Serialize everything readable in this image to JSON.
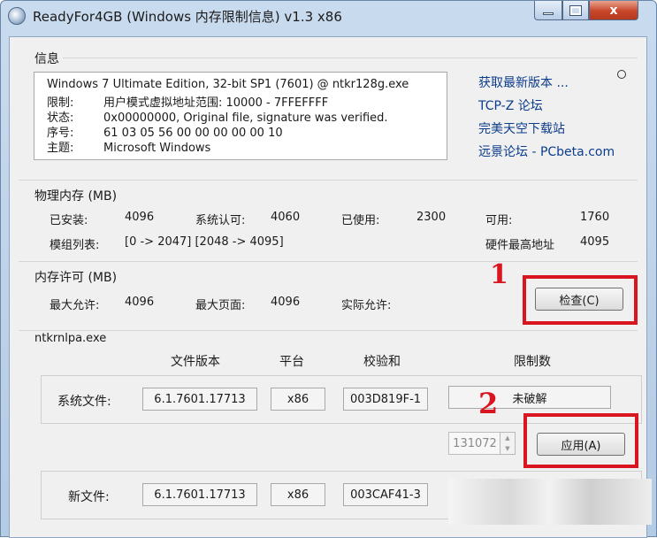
{
  "window": {
    "title": "ReadyFor4GB (Windows 内存限制信息) v1.3 x86",
    "close_glyph": "x"
  },
  "info": {
    "section_title": "信息",
    "line1": "Windows 7 Ultimate Edition, 32-bit SP1 (7601) @ ntkr128g.exe",
    "rows": [
      {
        "key": "限制:",
        "value": "用户模式虚拟地址范围:  10000 - 7FFEFFFF"
      },
      {
        "key": "状态:",
        "value": "0x00000000, Original file, signature was verified."
      },
      {
        "key": "序号:",
        "value": "61 03 05 56 00 00 00 00 00 10"
      },
      {
        "key": "主题:",
        "value": "Microsoft Windows"
      }
    ],
    "links": [
      "获取最新版本 ...",
      "TCP-Z 论坛",
      "完美天空下载站",
      "远景论坛 - PCbeta.com"
    ]
  },
  "physical": {
    "section_title": "物理内存 (MB)",
    "installed_label": "已安装:",
    "installed_value": "4096",
    "system_label": "系统认可:",
    "system_value": "4060",
    "used_label": "已使用:",
    "used_value": "2300",
    "available_label": "可用:",
    "available_value": "1760",
    "modules_label": "模组列表:",
    "modules_value": "[0 -> 2047]  [2048 -> 4095]",
    "hw_max_label": "硬件最高地址",
    "hw_max_value": "4095"
  },
  "license": {
    "section_title": "内存许可 (MB)",
    "max_allow_label": "最大允许:",
    "max_allow_value": "4096",
    "max_page_label": "最大页面:",
    "max_page_value": "4096",
    "actual_label": "实际允许:",
    "check_button": "检查(C)"
  },
  "ntkrnl": {
    "section_title": "ntkrnlpa.exe",
    "headers": {
      "version": "文件版本",
      "platform": "平台",
      "checksum": "校验和",
      "limit": "限制数"
    },
    "system_file": {
      "label": "系统文件:",
      "version": "6.1.7601.17713",
      "platform": "x86",
      "checksum": "003D819F-1",
      "limit": "未破解"
    },
    "spin_value": "131072",
    "apply_button": "应用(A)",
    "new_file": {
      "label": "新文件:",
      "version": "6.1.7601.17713",
      "platform": "x86",
      "checksum": "003CAF41-3"
    }
  },
  "annotations": {
    "mark1": "1",
    "mark2": "2",
    "color": "#d9161f"
  }
}
